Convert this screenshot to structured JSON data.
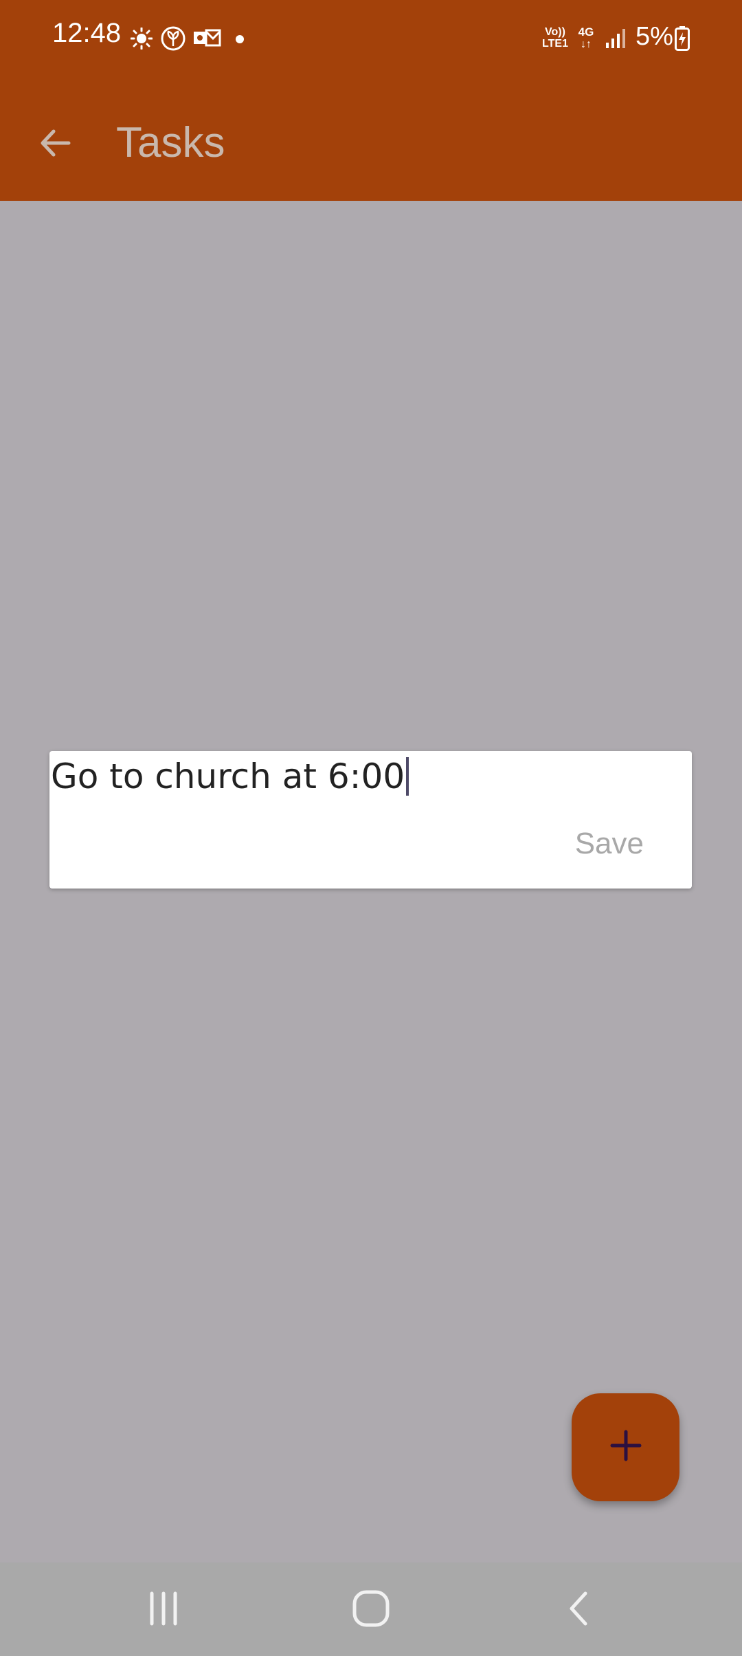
{
  "status_bar": {
    "time": "12:48",
    "battery": "5%",
    "network_label_top": "Vo))",
    "network_label_bottom": "LTE1",
    "data_type": "4G",
    "icons": [
      "brightness-icon",
      "leaf-icon",
      "outlook-icon",
      "dot-icon",
      "volte-icon",
      "4g-icon",
      "signal-icon",
      "battery-charging-icon"
    ]
  },
  "app_bar": {
    "title": "Tasks",
    "back_icon": "arrow-left-icon"
  },
  "dialog": {
    "input_value": "Go to church at 6:00",
    "save_label": "Save"
  },
  "fab": {
    "icon": "plus-icon"
  },
  "nav_bar": {
    "icons": [
      "recents-icon",
      "home-icon",
      "back-icon"
    ]
  },
  "colors": {
    "primary": "#a3410a",
    "scrim": "#aeaaaf",
    "nav_bar": "#a9a9a9",
    "fab_icon": "#2b1040"
  }
}
